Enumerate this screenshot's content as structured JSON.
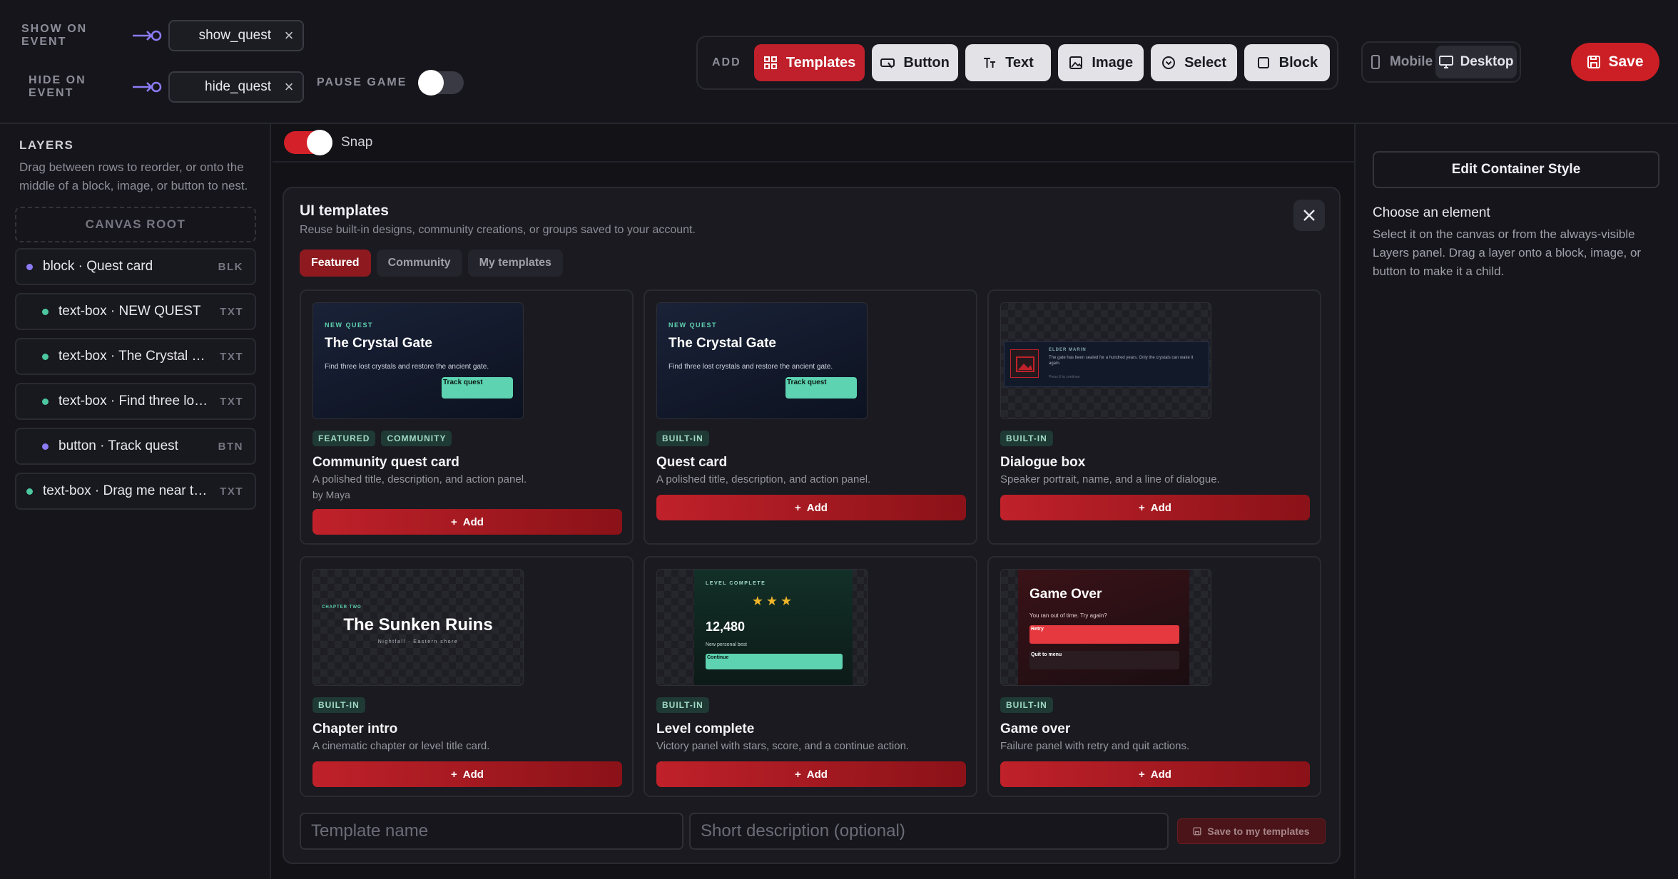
{
  "events": {
    "show_label": "SHOW ON EVENT",
    "show_value": "show_quest",
    "hide_label": "HIDE ON EVENT",
    "hide_value": "hide_quest",
    "pause_label": "PAUSE GAME",
    "pause_on": false
  },
  "toolbar": {
    "add_label": "ADD",
    "buttons": [
      "Templates",
      "Button",
      "Text",
      "Image",
      "Select",
      "Block"
    ],
    "devices": [
      "Mobile",
      "Desktop"
    ],
    "active_device": "Desktop",
    "save_label": "Save"
  },
  "layers": {
    "title": "LAYERS",
    "hint": "Drag between rows to reorder, or onto the middle of a block, image, or button to nest.",
    "root_label": "CANVAS ROOT",
    "items": [
      {
        "label": "block · Quest card",
        "tag": "BLK",
        "dot_color": "#8b7cf6"
      },
      {
        "label": "text-box · NEW QUEST",
        "tag": "TXT",
        "dot_color": "#4cc79f"
      },
      {
        "label": "text-box · The Crystal Gate",
        "tag": "TXT",
        "dot_color": "#4cc79f"
      },
      {
        "label": "text-box · Find three lost crystals and restore the ancient gate.",
        "tag": "TXT",
        "dot_color": "#4cc79f"
      },
      {
        "label": "button · Track quest",
        "tag": "BTN",
        "dot_color": "#8b7cf6"
      },
      {
        "label": "text-box · Drag me near the block",
        "tag": "TXT",
        "dot_color": "#4cc79f"
      }
    ]
  },
  "canvas": {
    "snap_label": "Snap",
    "snap_on": true
  },
  "templates": {
    "title": "UI templates",
    "subtitle": "Reuse built-in designs, community creations, or groups saved to your account.",
    "tabs": [
      "Featured",
      "Community",
      "My templates"
    ],
    "active_tab": "Featured",
    "add_label": "Add",
    "cards": [
      {
        "title": "Community quest card",
        "desc": "A polished title, description, and action panel.",
        "by": "by Maya",
        "badges": [
          "FEATURED",
          "COMMUNITY"
        ]
      },
      {
        "title": "Quest card",
        "desc": "A polished title, description, and action panel.",
        "badges": [
          "BUILT-IN"
        ]
      },
      {
        "title": "Dialogue box",
        "desc": "Speaker portrait, name, and a line of dialogue.",
        "badges": [
          "BUILT-IN"
        ]
      },
      {
        "title": "Chapter intro",
        "desc": "A cinematic chapter or level title card.",
        "badges": [
          "BUILT-IN"
        ]
      },
      {
        "title": "Level complete",
        "desc": "Victory panel with stars, score, and a continue action.",
        "badges": [
          "BUILT-IN"
        ]
      },
      {
        "title": "Game over",
        "desc": "Failure panel with retry and quit actions.",
        "badges": [
          "BUILT-IN"
        ]
      }
    ],
    "previews": {
      "quest": {
        "kicker": "NEW QUEST",
        "title": "The Crystal Gate",
        "desc": "Find three lost crystals and restore the ancient gate.",
        "button": "Track quest"
      },
      "dialogue": {
        "name": "ELDER MARIN",
        "line": "The gate has been sealed for a hundred years. Only the crystals can wake it again.",
        "cont": "Press E to continue"
      },
      "chapter": {
        "kicker": "CHAPTER TWO",
        "title": "The Sunken Ruins",
        "sub": "Nightfall · Eastern shore"
      },
      "level": {
        "kicker": "LEVEL COMPLETE",
        "stars": "★★★",
        "score": "12,480",
        "best": "New personal best",
        "button": "Continue"
      },
      "gameover": {
        "title": "Game Over",
        "desc": "You ran out of time. Try again?",
        "retry": "Retry",
        "quit": "Quit to menu"
      }
    },
    "name_placeholder": "Template name",
    "desc_placeholder": "Short description (optional)",
    "save_label": "Save to my templates"
  },
  "inspector": {
    "edit_label": "Edit Container Style",
    "choose_title": "Choose an element",
    "choose_hint": "Select it on the canvas or from the always-visible Layers panel. Drag a layer onto a block, image, or button to make it a child."
  },
  "colors": {
    "accent": "#c0202b",
    "teal": "#5dd3b1",
    "bg": "#121217"
  }
}
